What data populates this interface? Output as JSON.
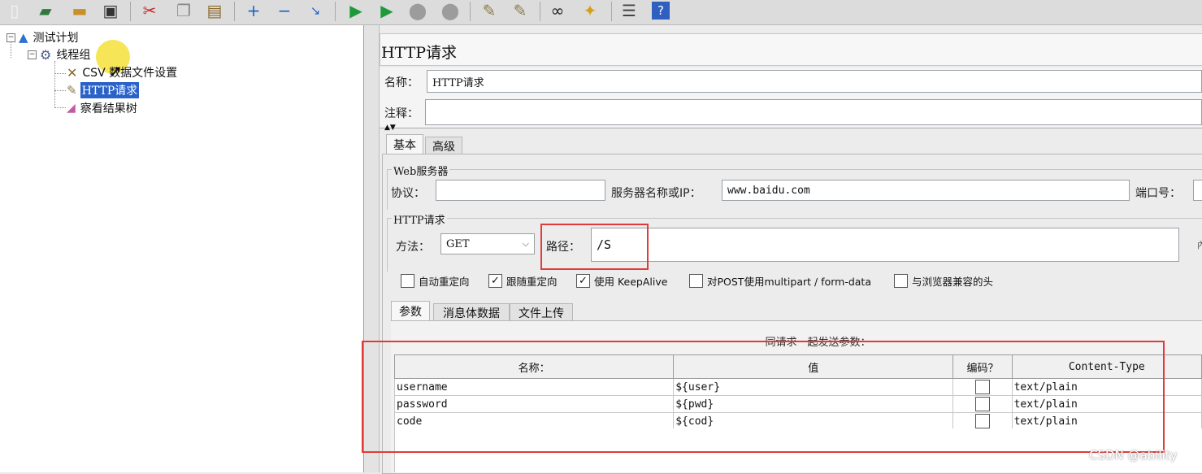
{
  "toolbar": {
    "icons": [
      "new-icon",
      "templates-icon",
      "open-icon",
      "save-icon",
      "cut-icon",
      "copy-icon",
      "paste-icon",
      "expand-icon",
      "collapse-icon",
      "toggle-icon",
      "start-icon",
      "start-no-pause-icon",
      "stop-icon",
      "shutdown-icon",
      "clear-icon",
      "clear-all-icon",
      "search-icon",
      "reset-search-icon",
      "function-helper-icon",
      "help-icon"
    ]
  },
  "tree": {
    "root": "测试计划",
    "thread_group": "线程组",
    "csv": "CSV 数据文件设置",
    "http": "HTTP请求",
    "results": "察看结果树"
  },
  "panel": {
    "title": "HTTP请求",
    "name_label": "名称：",
    "name_value": "HTTP请求",
    "comment_label": "注释：",
    "comment_value": ""
  },
  "tabs": {
    "basic": "基本",
    "advanced": "高级"
  },
  "web_server": {
    "group_title": "Web服务器",
    "protocol_label": "协议：",
    "protocol_value": "",
    "server_label": "服务器名称或IP：",
    "server_value": "www.baidu.com",
    "port_label": "端口号："
  },
  "http_request": {
    "group_title": "HTTP请求",
    "method_label": "方法：",
    "method_value": "GET",
    "path_label": "路径：",
    "path_value": "/S"
  },
  "options": [
    {
      "label": "自动重定向",
      "checked": false
    },
    {
      "label": "跟随重定向",
      "checked": true
    },
    {
      "label": "使用 KeepAlive",
      "checked": true
    },
    {
      "label": "对POST使用multipart / form-data",
      "checked": false
    },
    {
      "label": "与浏览器兼容的头",
      "checked": false
    }
  ],
  "sub_tabs": {
    "params": "参数",
    "body": "消息体数据",
    "files": "文件上传"
  },
  "params": {
    "caption": "同请求一起发送参数：",
    "headers": [
      "名称：",
      "值",
      "编码？",
      "Content-Type"
    ],
    "rows": [
      {
        "name": "username",
        "value": "${user}",
        "encode": false,
        "content_type": "text/plain"
      },
      {
        "name": "password",
        "value": "${pwd}",
        "encode": false,
        "content_type": "text/plain"
      },
      {
        "name": "code",
        "value": "${cod}",
        "encode": false,
        "content_type": "text/plain"
      }
    ]
  },
  "watermark": "CSDN @ability",
  "colors": {
    "selection": "#2a62c9",
    "annotation_box": "#e23a3a"
  }
}
